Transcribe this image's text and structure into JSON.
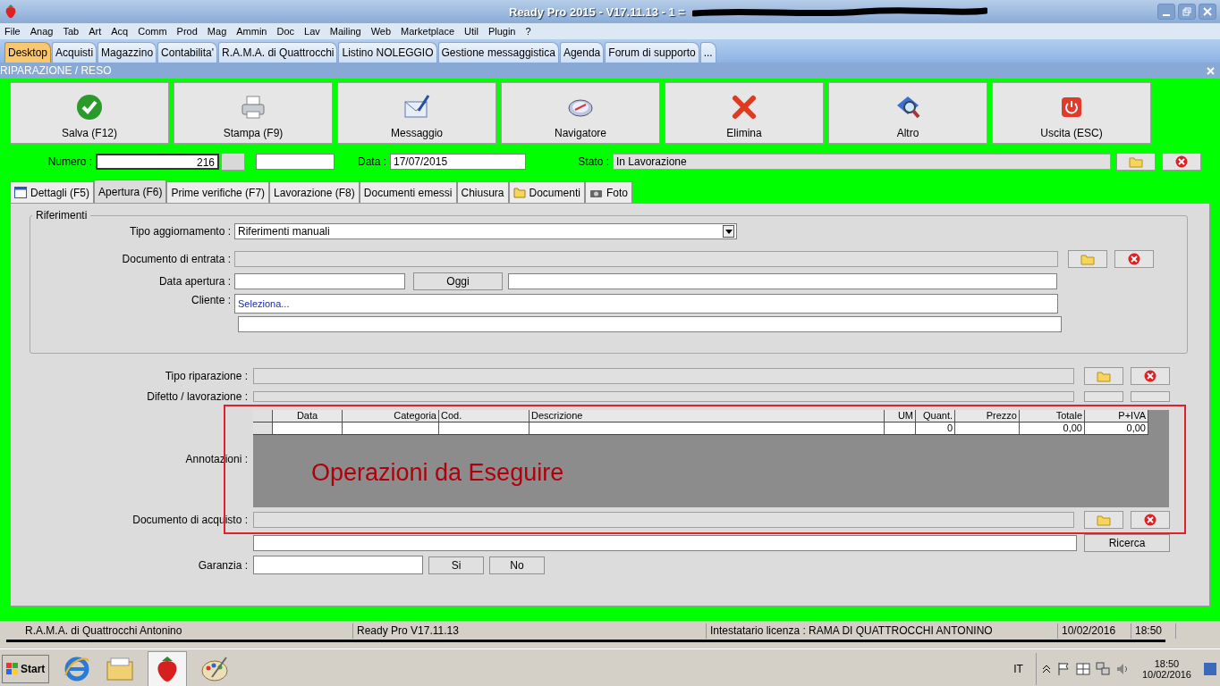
{
  "window": {
    "title": "Ready Pro 2015 - V17.11.13 - 1 ="
  },
  "menu": [
    "File",
    "Anag",
    "Tab",
    "Art",
    "Acq",
    "Comm",
    "Prod",
    "Mag",
    "Ammin",
    "Doc",
    "Lav",
    "Mailing",
    "Web",
    "Marketplace",
    "Util",
    "Plugin",
    "?"
  ],
  "desktop_tabs": [
    {
      "label": "Desktop",
      "selected": true
    },
    {
      "label": "Acquisti",
      "selected": false
    },
    {
      "label": "Magazzino",
      "selected": false
    },
    {
      "label": "Contabilita'",
      "selected": false
    },
    {
      "label": "R.A.M.A. di Quattrocchi",
      "selected": false
    },
    {
      "label": "Listino NOLEGGIO",
      "selected": false
    },
    {
      "label": "Gestione messaggistica",
      "selected": false
    },
    {
      "label": "Agenda",
      "selected": false
    },
    {
      "label": "Forum di supporto",
      "selected": false
    },
    {
      "label": "...",
      "selected": false
    }
  ],
  "form_title": "RIPARAZIONE / RESO",
  "toolbar": [
    {
      "label": "Salva (F12)",
      "kind": "check"
    },
    {
      "label": "Stampa (F9)",
      "kind": "printer"
    },
    {
      "label": "Messaggio",
      "kind": "envelope"
    },
    {
      "label": "Navigatore",
      "kind": "compass"
    },
    {
      "label": "Elimina",
      "kind": "cross"
    },
    {
      "label": "Altro",
      "kind": "magnifier"
    },
    {
      "label": "Uscita (ESC)",
      "kind": "power"
    }
  ],
  "header": {
    "numero_label": "Numero :",
    "numero": "216",
    "data_label": "Data :",
    "data": "17/07/2015",
    "stato_label": "Stato :",
    "stato": "In Lavorazione"
  },
  "form_tabs": [
    {
      "label": "Dettagli (F5)",
      "selected": false,
      "kind": "calendar"
    },
    {
      "label": "Apertura (F6)",
      "selected": true,
      "kind": "plain"
    },
    {
      "label": "Prime verifiche (F7)",
      "selected": false,
      "kind": "plain"
    },
    {
      "label": "Lavorazione (F8)",
      "selected": false,
      "kind": "plain"
    },
    {
      "label": "Documenti emessi",
      "selected": false,
      "kind": "plain"
    },
    {
      "label": "Chiusura",
      "selected": false,
      "kind": "plain"
    },
    {
      "label": "Documenti",
      "selected": false,
      "kind": "folder"
    },
    {
      "label": "Foto",
      "selected": false,
      "kind": "camera"
    }
  ],
  "riferimenti": {
    "title": "Riferimenti",
    "tipo_aggiornamento_label": "Tipo aggiornamento :",
    "tipo_aggiornamento": "Riferimenti manuali",
    "documento_entrata_label": "Documento di entrata :",
    "data_apertura_label": "Data apertura :",
    "oggi_button": "Oggi",
    "cliente_label": "Cliente :",
    "cliente": "Seleziona..."
  },
  "tipo_riparazione_label": "Tipo riparazione :",
  "difetto_label": "Difetto / lavorazione :",
  "annotazioni_label": "Annotazioni :",
  "grid": {
    "columns": [
      {
        "label": "Data"
      },
      {
        "label": "Categoria"
      },
      {
        "label": "Cod."
      },
      {
        "label": "Descrizione"
      },
      {
        "label": "UM"
      },
      {
        "label": "Quant.",
        "values": [
          "0"
        ]
      },
      {
        "label": "Prezzo"
      },
      {
        "label": "Totale",
        "values": [
          "0,00"
        ]
      },
      {
        "label": "P+IVA",
        "values": [
          "0,00"
        ]
      }
    ]
  },
  "annotation": "Operazioni da Eseguire",
  "documento_acquisto_label": "Documento di acquisto :",
  "ricerca_button": "Ricerca",
  "garanzia_label": "Garanzia :",
  "garanzia_buttons": [
    "Si",
    "No"
  ],
  "status_bar": [
    "R.A.M.A. di Quattrocchi Antonino",
    "Ready Pro V17.11.13",
    "Intestatario licenza : RAMA DI QUATTROCCHI ANTONINO",
    "10/02/2016",
    "18:50"
  ],
  "taskbar": {
    "start": "Start",
    "language": "IT",
    "time": "18:50",
    "date": "10/02/2016"
  }
}
